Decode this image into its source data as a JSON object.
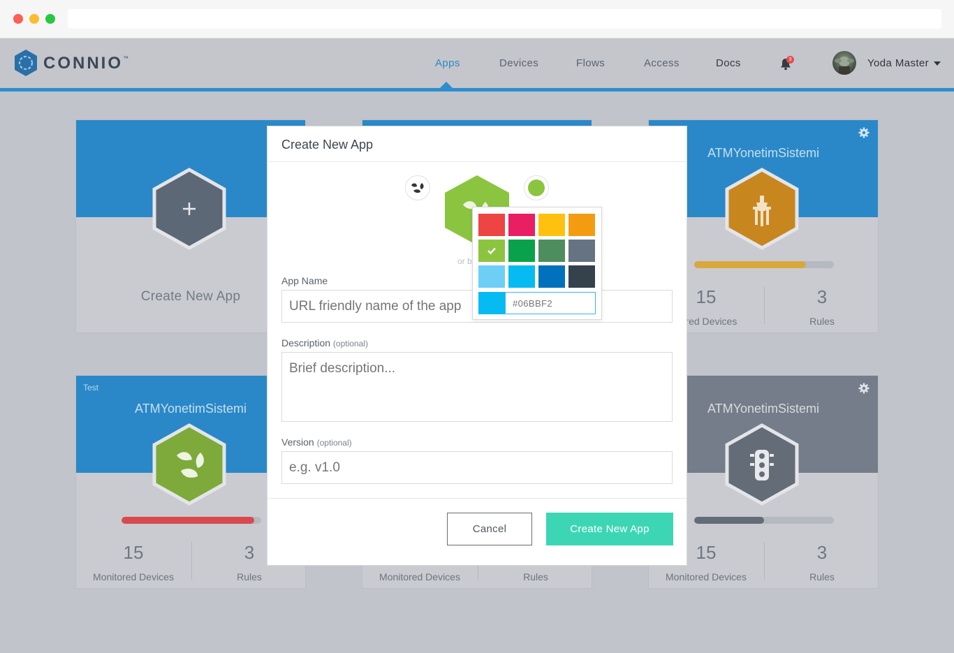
{
  "nav": {
    "logo_text": "CONNIO",
    "logo_tm": "™",
    "items": [
      {
        "label": "Apps"
      },
      {
        "label": "Devices"
      },
      {
        "label": "Flows"
      },
      {
        "label": "Access"
      },
      {
        "label": "Docs"
      }
    ],
    "notification_count": "3",
    "user_name": "Yoda Master"
  },
  "cards": [
    {
      "label": "Create New  App"
    },
    {
      "title": "ATMYonetimSistemi",
      "progress": 0.8,
      "bar_color": "#d8a83c",
      "hex_color": "#c8861f",
      "icon": "street-lamp-icon",
      "devices_count": "15",
      "devices_label": "itored Devices",
      "rules_count": "3",
      "rules_label": "Rules"
    },
    {
      "tag": "Test",
      "title": "ATMYonetimSistemi",
      "progress": 0.95,
      "bar_color": "#d84a4f",
      "hex_color": "#7daa3a",
      "icon": "leaf-icon",
      "devices_count": "15",
      "devices_label": "Monitored Devices",
      "rules_count": "3",
      "rules_label": "Rules"
    },
    {
      "devices_label": "Monitored Devices",
      "rules_label": "Rules"
    },
    {
      "title": "ATMYonetimSistemi",
      "progress": 0.5,
      "bar_color": "#646c78",
      "hex_color": "#646c78",
      "icon": "traffic-light-icon",
      "devices_count": "15",
      "devices_label": "Monitored Devices",
      "rules_count": "3",
      "rules_label": "Rules"
    }
  ],
  "modal": {
    "title": "Create New App",
    "or_text": "or b",
    "app_name_label": "App Name",
    "app_name_placeholder": "URL friendly name of the app",
    "description_label": "Description",
    "description_optional": "(optional)",
    "description_placeholder": "Brief description...",
    "version_label": "Version",
    "version_optional": "(optional)",
    "version_placeholder": "e.g. v1.0",
    "cancel_label": "Cancel",
    "create_label": "Create New App",
    "selected_color": "#8bc53f"
  },
  "color_picker": {
    "swatches": [
      "#ee4444",
      "#e91e63",
      "#ffc10e",
      "#f39c12",
      "#8bc53f",
      "#0aa14b",
      "#4e8d5d",
      "#657383",
      "#6dcff6",
      "#06bbf2",
      "#0072bc",
      "#35414b"
    ],
    "selected_index": 4,
    "hex_placeholder": "#06BBF2",
    "preview_color": "#06bbf2"
  }
}
